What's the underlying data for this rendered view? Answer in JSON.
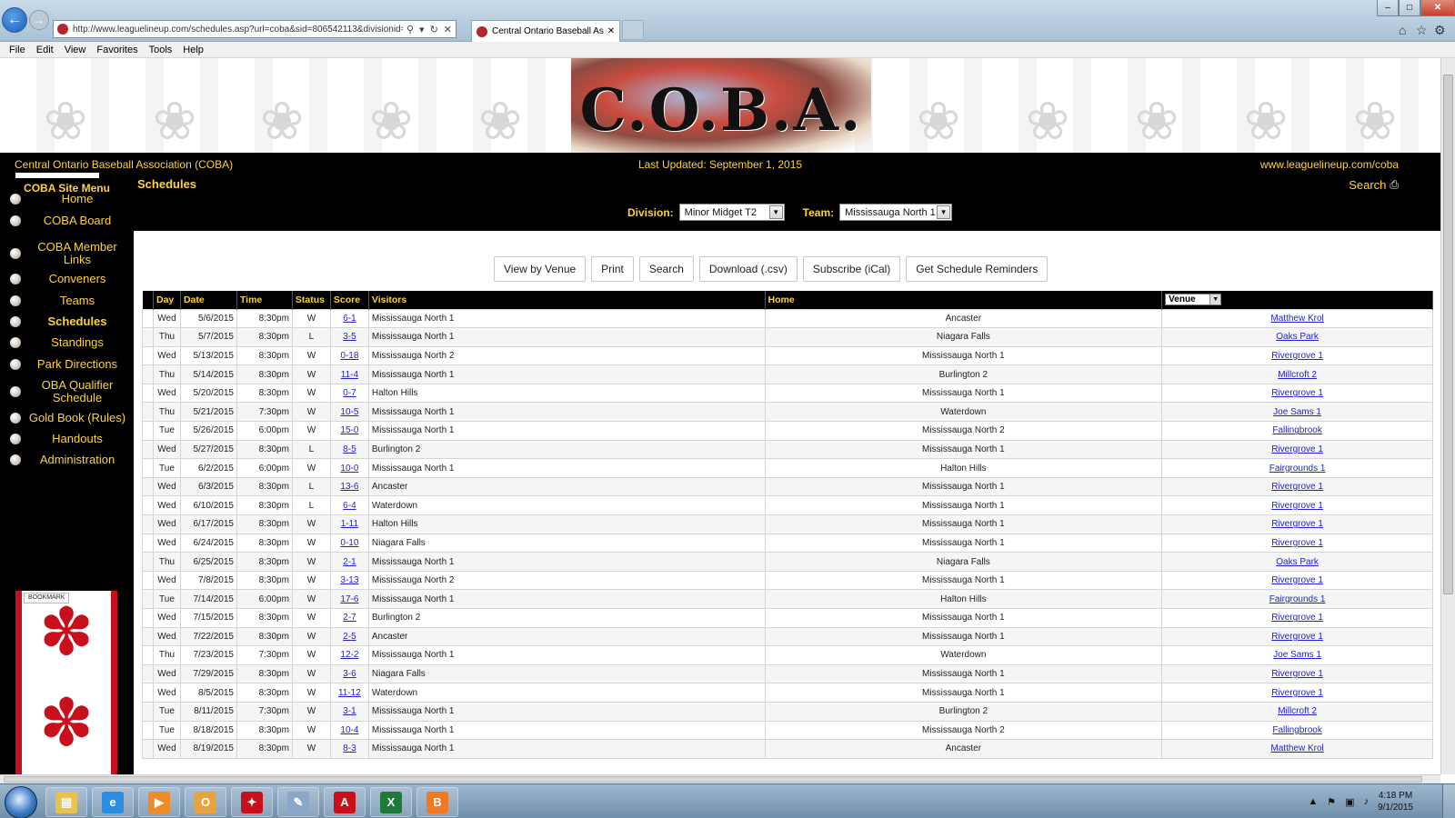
{
  "browser": {
    "url": "http://www.leaguelineup.com/schedules.asp?url=coba&sid=806542113&divisionid=",
    "tab_title": "Central Ontario Baseball As...",
    "menu": [
      "File",
      "Edit",
      "View",
      "Favorites",
      "Tools",
      "Help"
    ]
  },
  "header": {
    "logo_text": "C.O.B.A.",
    "org_name": "Central Ontario Baseball Association (COBA)",
    "last_updated": "Last Updated: September 1, 2015",
    "site_url": "www.leaguelineup.com/coba",
    "section_title": "Schedules",
    "search_label": "Search"
  },
  "filters": {
    "division_label": "Division:",
    "division_value": "Minor Midget T2",
    "team_label": "Team:",
    "team_value": "Mississauga North 1"
  },
  "sidebar": {
    "title": "COBA Site Menu",
    "items": [
      {
        "label": "Home"
      },
      {
        "label": "COBA Board"
      },
      {
        "label": "COBA Member Links"
      },
      {
        "label": "Conveners"
      },
      {
        "label": "Teams"
      },
      {
        "label": "Schedules",
        "active": true
      },
      {
        "label": "Standings"
      },
      {
        "label": "Park Directions"
      },
      {
        "label": "OBA Qualifier Schedule"
      },
      {
        "label": "Gold Book (Rules)"
      },
      {
        "label": "Handouts"
      },
      {
        "label": "Administration"
      }
    ],
    "bookmark_label": "BOOKMARK"
  },
  "buttons": [
    "View by Venue",
    "Print",
    "Search",
    "Download (.csv)",
    "Subscribe (iCal)",
    "Get Schedule Reminders"
  ],
  "table": {
    "headers": {
      "day": "Day",
      "date": "Date",
      "time": "Time",
      "status": "Status",
      "score": "Score",
      "visitors": "Visitors",
      "home": "Home",
      "venue": "Venue"
    },
    "rows": [
      {
        "day": "Wed",
        "date": "5/6/2015",
        "time": "8:30pm",
        "status": "W",
        "score": "6-1",
        "visitors": "Mississauga North 1",
        "home": "Ancaster",
        "venue": "Matthew Krol"
      },
      {
        "day": "Thu",
        "date": "5/7/2015",
        "time": "8:30pm",
        "status": "L",
        "score": "3-5",
        "visitors": "Mississauga North 1",
        "home": "Niagara Falls",
        "venue": "Oaks Park"
      },
      {
        "day": "Wed",
        "date": "5/13/2015",
        "time": "8:30pm",
        "status": "W",
        "score": "0-18",
        "visitors": "Mississauga North 2",
        "home": "Mississauga North 1",
        "venue": "Rivergrove 1"
      },
      {
        "day": "Thu",
        "date": "5/14/2015",
        "time": "8:30pm",
        "status": "W",
        "score": "11-4",
        "visitors": "Mississauga North 1",
        "home": "Burlington 2",
        "venue": "Millcroft 2"
      },
      {
        "day": "Wed",
        "date": "5/20/2015",
        "time": "8:30pm",
        "status": "W",
        "score": "0-7",
        "visitors": "Halton Hills",
        "home": "Mississauga North 1",
        "venue": "Rivergrove 1"
      },
      {
        "day": "Thu",
        "date": "5/21/2015",
        "time": "7:30pm",
        "status": "W",
        "score": "10-5",
        "visitors": "Mississauga North 1",
        "home": "Waterdown",
        "venue": "Joe Sams 1"
      },
      {
        "day": "Tue",
        "date": "5/26/2015",
        "time": "6:00pm",
        "status": "W",
        "score": "15-0",
        "visitors": "Mississauga North 1",
        "home": "Mississauga North 2",
        "venue": "Fallingbrook"
      },
      {
        "day": "Wed",
        "date": "5/27/2015",
        "time": "8:30pm",
        "status": "L",
        "score": "8-5",
        "visitors": "Burlington 2",
        "home": "Mississauga North 1",
        "venue": "Rivergrove 1"
      },
      {
        "day": "Tue",
        "date": "6/2/2015",
        "time": "6:00pm",
        "status": "W",
        "score": "10-0",
        "visitors": "Mississauga North 1",
        "home": "Halton Hills",
        "venue": "Fairgrounds 1"
      },
      {
        "day": "Wed",
        "date": "6/3/2015",
        "time": "8:30pm",
        "status": "L",
        "score": "13-6",
        "visitors": "Ancaster",
        "home": "Mississauga North 1",
        "venue": "Rivergrove 1"
      },
      {
        "day": "Wed",
        "date": "6/10/2015",
        "time": "8:30pm",
        "status": "L",
        "score": "6-4",
        "visitors": "Waterdown",
        "home": "Mississauga North 1",
        "venue": "Rivergrove 1"
      },
      {
        "day": "Wed",
        "date": "6/17/2015",
        "time": "8:30pm",
        "status": "W",
        "score": "1-11",
        "visitors": "Halton Hills",
        "home": "Mississauga North 1",
        "venue": "Rivergrove 1"
      },
      {
        "day": "Wed",
        "date": "6/24/2015",
        "time": "8:30pm",
        "status": "W",
        "score": "0-10",
        "visitors": "Niagara Falls",
        "home": "Mississauga North 1",
        "venue": "Rivergrove 1"
      },
      {
        "day": "Thu",
        "date": "6/25/2015",
        "time": "8:30pm",
        "status": "W",
        "score": "2-1",
        "visitors": "Mississauga North 1",
        "home": "Niagara Falls",
        "venue": "Oaks Park"
      },
      {
        "day": "Wed",
        "date": "7/8/2015",
        "time": "8:30pm",
        "status": "W",
        "score": "3-13",
        "visitors": "Mississauga North 2",
        "home": "Mississauga North 1",
        "venue": "Rivergrove 1"
      },
      {
        "day": "Tue",
        "date": "7/14/2015",
        "time": "6:00pm",
        "status": "W",
        "score": "17-6",
        "visitors": "Mississauga North 1",
        "home": "Halton Hills",
        "venue": "Fairgrounds 1"
      },
      {
        "day": "Wed",
        "date": "7/15/2015",
        "time": "8:30pm",
        "status": "W",
        "score": "2-7",
        "visitors": "Burlington 2",
        "home": "Mississauga North 1",
        "venue": "Rivergrove 1"
      },
      {
        "day": "Wed",
        "date": "7/22/2015",
        "time": "8:30pm",
        "status": "W",
        "score": "2-5",
        "visitors": "Ancaster",
        "home": "Mississauga North 1",
        "venue": "Rivergrove 1"
      },
      {
        "day": "Thu",
        "date": "7/23/2015",
        "time": "7:30pm",
        "status": "W",
        "score": "12-2",
        "visitors": "Mississauga North 1",
        "home": "Waterdown",
        "venue": "Joe Sams 1"
      },
      {
        "day": "Wed",
        "date": "7/29/2015",
        "time": "8:30pm",
        "status": "W",
        "score": "3-6",
        "visitors": "Niagara Falls",
        "home": "Mississauga North 1",
        "venue": "Rivergrove 1"
      },
      {
        "day": "Wed",
        "date": "8/5/2015",
        "time": "8:30pm",
        "status": "W",
        "score": "11-12",
        "visitors": "Waterdown",
        "home": "Mississauga North 1",
        "venue": "Rivergrove 1"
      },
      {
        "day": "Tue",
        "date": "8/11/2015",
        "time": "7:30pm",
        "status": "W",
        "score": "3-1",
        "visitors": "Mississauga North 1",
        "home": "Burlington 2",
        "venue": "Millcroft 2"
      },
      {
        "day": "Tue",
        "date": "8/18/2015",
        "time": "8:30pm",
        "status": "W",
        "score": "10-4",
        "visitors": "Mississauga North 1",
        "home": "Mississauga North 2",
        "venue": "Fallingbrook"
      },
      {
        "day": "Wed",
        "date": "8/19/2015",
        "time": "8:30pm",
        "status": "W",
        "score": "8-3",
        "visitors": "Mississauga North 1",
        "home": "Ancaster",
        "venue": "Matthew Krol"
      }
    ],
    "highlight_team": "Mississauga North 1"
  },
  "taskbar": {
    "apps": [
      {
        "name": "file-explorer",
        "glyph": "▤",
        "color": "#e8c24a"
      },
      {
        "name": "internet-explorer",
        "glyph": "e",
        "color": "#2d8de0"
      },
      {
        "name": "media-player",
        "glyph": "▶",
        "color": "#f08a24"
      },
      {
        "name": "outlook",
        "glyph": "O",
        "color": "#e8a33a"
      },
      {
        "name": "flag-app",
        "glyph": "✦",
        "color": "#c8101c"
      },
      {
        "name": "paint",
        "glyph": "✎",
        "color": "#8aa6c8"
      },
      {
        "name": "acrobat",
        "glyph": "A",
        "color": "#c8101c"
      },
      {
        "name": "excel",
        "glyph": "X",
        "color": "#1f7a3a"
      },
      {
        "name": "blogger",
        "glyph": "B",
        "color": "#f07a24"
      }
    ],
    "time": "4:18 PM",
    "date": "9/1/2015"
  },
  "colors": {
    "accent_gold": "#ffd23a",
    "win_green": "#2e8b2e",
    "loss_red": "#d21f1f",
    "link_blue": "#2222cc",
    "flag_red": "#c8101c"
  }
}
